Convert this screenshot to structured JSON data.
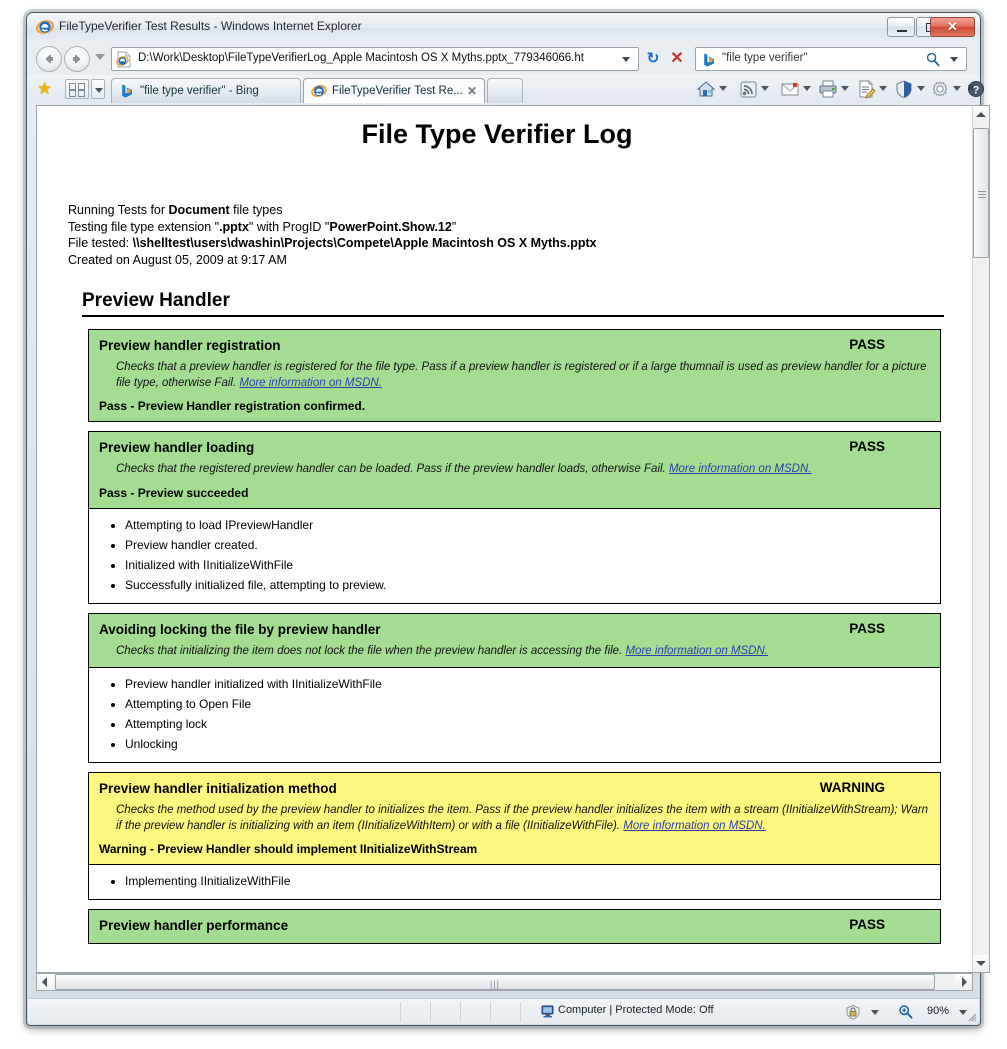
{
  "window": {
    "title": "FileTypeVerifier Test Results - Windows Internet Explorer",
    "icon": "ie-logo-icon",
    "controls": {
      "minimize": "–",
      "maximize": "□",
      "close": "✕"
    }
  },
  "navigation": {
    "back_label": "Back",
    "forward_label": "Forward",
    "recent_pages_label": "Recent Pages",
    "address": {
      "value": "D:\\Work\\Desktop\\FileTypeVerifierLog_Apple Macintosh OS X Myths.pptx_779346066.ht",
      "placeholder": "Address"
    },
    "refresh_label": "↻",
    "stop_label": "✕"
  },
  "search": {
    "provider_icon": "bing-icon",
    "value": "\"file type verifier\"",
    "placeholder": "Search",
    "go_label": "Search"
  },
  "tabs": {
    "favorites_label": "Favorites",
    "quick_tabs_label": "Quick Tabs",
    "items": [
      {
        "label": "\"file type verifier\" - Bing",
        "icon": "bing-icon",
        "active": false,
        "close": "✕"
      },
      {
        "label": "FileTypeVerifier Test Re...",
        "icon": "ie-logo-icon",
        "active": true,
        "close": "✕"
      }
    ],
    "new_tab_label": "New Tab"
  },
  "command_bar": {
    "items": [
      {
        "name": "home-icon",
        "label": "Home"
      },
      {
        "name": "feeds-icon",
        "label": "Feeds"
      },
      {
        "name": "mail-icon",
        "label": "Read Mail"
      },
      {
        "name": "print-icon",
        "label": "Print"
      },
      {
        "name": "page-icon",
        "label": "Page"
      },
      {
        "name": "safety-shield-icon",
        "label": "Safety"
      },
      {
        "name": "tools-gear-icon",
        "label": "Tools"
      },
      {
        "name": "help-icon",
        "label": "Help"
      }
    ],
    "overflow_label": "»"
  },
  "document": {
    "title": "File Type Verifier Log",
    "intro": [
      {
        "prefix": "Running Tests for ",
        "bold": "Document",
        "suffix": " file types"
      },
      {
        "prefix": "Testing file type extension \"",
        "bold": ".pptx",
        "suffix": "\" with ProgID \"",
        "bold2": "PowerPoint.Show.12",
        "suffix2": "\""
      },
      {
        "prefix": "File tested: ",
        "bold": "\\\\shelltest\\users\\dwashin\\Projects\\Compete\\Apple Macintosh OS X Myths.pptx",
        "suffix": ""
      },
      {
        "prefix": "Created on August 05, 2009 at 9:17 AM",
        "bold": "",
        "suffix": ""
      }
    ],
    "section_title": "Preview Handler",
    "link_text": "More information on MSDN.",
    "tests": [
      {
        "name": "Preview handler registration",
        "status": "PASS",
        "level": "pass",
        "description": "Checks that a preview handler is registered for the file type. Pass if a preview handler is registered or if a large thumnail is used as preview handler for a picture file type, otherwise Fail. ",
        "link": "More information on MSDN.",
        "result": "Pass - Preview Handler registration confirmed.",
        "details": []
      },
      {
        "name": "Preview handler loading",
        "status": "PASS",
        "level": "pass",
        "description": "Checks that the registered preview handler can be loaded. Pass if the preview handler loads, otherwise Fail. ",
        "link": "More information on MSDN.",
        "result": "Pass - Preview succeeded",
        "details": [
          "Attempting to load IPreviewHandler",
          "Preview handler created.",
          "Initialized with IInitializeWithFile",
          "Successfully initialized file, attempting to preview."
        ]
      },
      {
        "name": "Avoiding locking the file by preview handler",
        "status": "PASS",
        "level": "pass",
        "description": "Checks that initializing the item does not lock the file when the preview handler is accessing the file. ",
        "link": "More information on MSDN.",
        "result": "",
        "details": [
          "Preview handler initialized with IInitializeWithFile",
          "Attempting to Open File",
          "Attempting lock",
          "Unlocking"
        ]
      },
      {
        "name": "Preview handler initialization method",
        "status": "WARNING",
        "level": "warn",
        "description": "Checks the method used by the preview handler to initializes the item. Pass if the preview handler initializes the item with a stream (IInitializeWithStream); Warn if the preview handler is initializing with an item (IInitializeWithItem) or with a file (IInitializeWithFile). ",
        "link": "More information on MSDN.",
        "result": "Warning - Preview Handler should implement IInitializeWithStream",
        "details": [
          "Implementing IInitializeWithFile"
        ]
      },
      {
        "name": "Preview handler performance",
        "status": "PASS",
        "level": "pass",
        "description": "",
        "link": "",
        "result": "",
        "details": []
      }
    ]
  },
  "status_bar": {
    "zone": "Computer | Protected Mode: Off",
    "zone_icon": "computer-icon",
    "zoom": "90%",
    "zoom_icon": "zoom-icon"
  },
  "colors": {
    "pass_background": "#a3dd92",
    "warning_background": "#fbf77f",
    "link": "#2b3fa8",
    "border": "#000000"
  }
}
